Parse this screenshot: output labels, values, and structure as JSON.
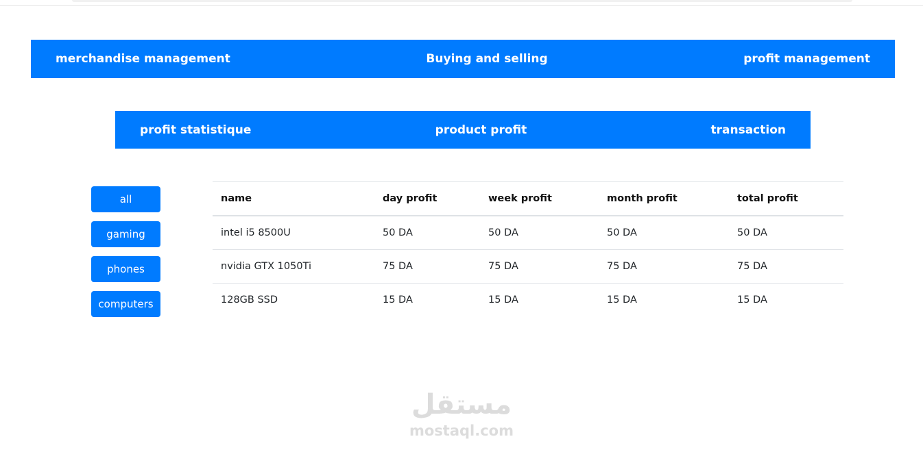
{
  "nav_main": {
    "items": [
      {
        "label": "merchandise management"
      },
      {
        "label": "Buying and selling"
      },
      {
        "label": "profit management"
      }
    ]
  },
  "nav_sub": {
    "items": [
      {
        "label": "profit statistique"
      },
      {
        "label": "product profit"
      },
      {
        "label": "transaction"
      }
    ]
  },
  "categories": [
    {
      "label": "all"
    },
    {
      "label": "gaming"
    },
    {
      "label": "phones"
    },
    {
      "label": "computers"
    }
  ],
  "table": {
    "headers": [
      "name",
      "day profit",
      "week profit",
      "month profit",
      "total profit"
    ],
    "rows": [
      [
        "intel i5 8500U",
        "50 DA",
        "50 DA",
        "50 DA",
        "50 DA"
      ],
      [
        "nvidia GTX 1050Ti",
        "75 DA",
        "75 DA",
        "75 DA",
        "75 DA"
      ],
      [
        "128GB SSD",
        "15 DA",
        "15 DA",
        "15 DA",
        "15 DA"
      ]
    ]
  },
  "watermark": {
    "arabic": "مستقل",
    "latin": "mostaql.com"
  },
  "colors": {
    "primary": "#007bff",
    "text": "#212529",
    "border": "#dee2e6",
    "watermark": "#dcdcdc"
  }
}
